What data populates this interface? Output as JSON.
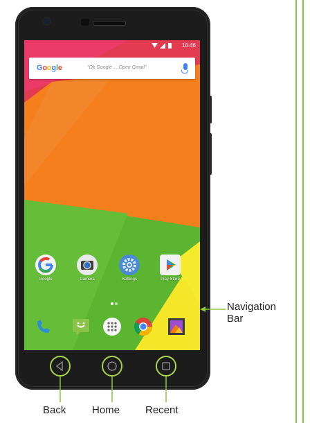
{
  "status_bar": {
    "time": "10:46"
  },
  "search": {
    "logo": "Google",
    "hint": "\"Ok Google ... Open Gmail\""
  },
  "apps": [
    {
      "label": "Google",
      "icon": "google-icon"
    },
    {
      "label": "Camera",
      "icon": "camera-icon"
    },
    {
      "label": "Settings",
      "icon": "settings-icon"
    },
    {
      "label": "Play Store",
      "icon": "play-store-icon"
    }
  ],
  "dock": [
    "phone-icon",
    "messaging-icon",
    "app-drawer-icon",
    "chrome-icon",
    "gallery-icon"
  ],
  "annotations": {
    "navigation": "Navigation",
    "bar": "Bar",
    "back": "Back",
    "home": "Home",
    "recent": "Recent"
  },
  "colors": {
    "callout": "#8bc53f",
    "nav_ring": "#a6d34a",
    "phone_body": "#1c1c1c"
  }
}
